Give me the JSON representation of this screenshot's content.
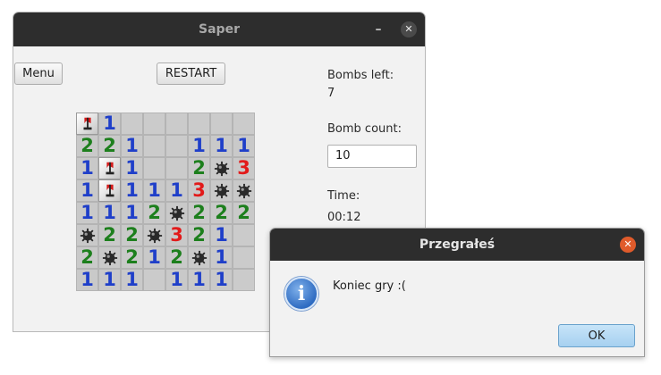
{
  "window": {
    "title": "Saper",
    "minimize_symbol": "–",
    "close_symbol": "✕"
  },
  "toolbar": {
    "menu_label": "Menu",
    "restart_label": "RESTART"
  },
  "side_panel": {
    "bombs_left_label": "Bombs left:",
    "bombs_left_value": "7",
    "bomb_count_label": "Bomb count:",
    "bomb_count_value": "10",
    "time_label": "Time:",
    "time_value": "00:12"
  },
  "board": {
    "rows": [
      [
        "F",
        "1",
        "",
        "",
        "",
        "",
        "",
        ""
      ],
      [
        "2",
        "2",
        "1",
        "",
        "",
        "1",
        "1",
        "1"
      ],
      [
        "1",
        "F",
        "1",
        "",
        "",
        "2",
        "M",
        "3"
      ],
      [
        "1",
        "F",
        "1",
        "1",
        "1",
        "3",
        "M",
        "M"
      ],
      [
        "1",
        "1",
        "1",
        "2",
        "M",
        "2",
        "2",
        "2"
      ],
      [
        "M",
        "2",
        "2",
        "M",
        "3",
        "2",
        "1",
        ""
      ],
      [
        "2",
        "M",
        "2",
        "1",
        "2",
        "M",
        "1",
        ""
      ],
      [
        "1",
        "1",
        "1",
        "",
        "1",
        "1",
        "1",
        ""
      ]
    ],
    "number_colors": {
      "1": "#1f3fc9",
      "2": "#1d7f1d",
      "3": "#e21a1a"
    }
  },
  "dialog": {
    "title": "Przegrałeś",
    "close_symbol": "✕",
    "icon": "info-icon",
    "icon_glyph": "i",
    "message": "Koniec gry :(",
    "ok_label": "OK"
  }
}
